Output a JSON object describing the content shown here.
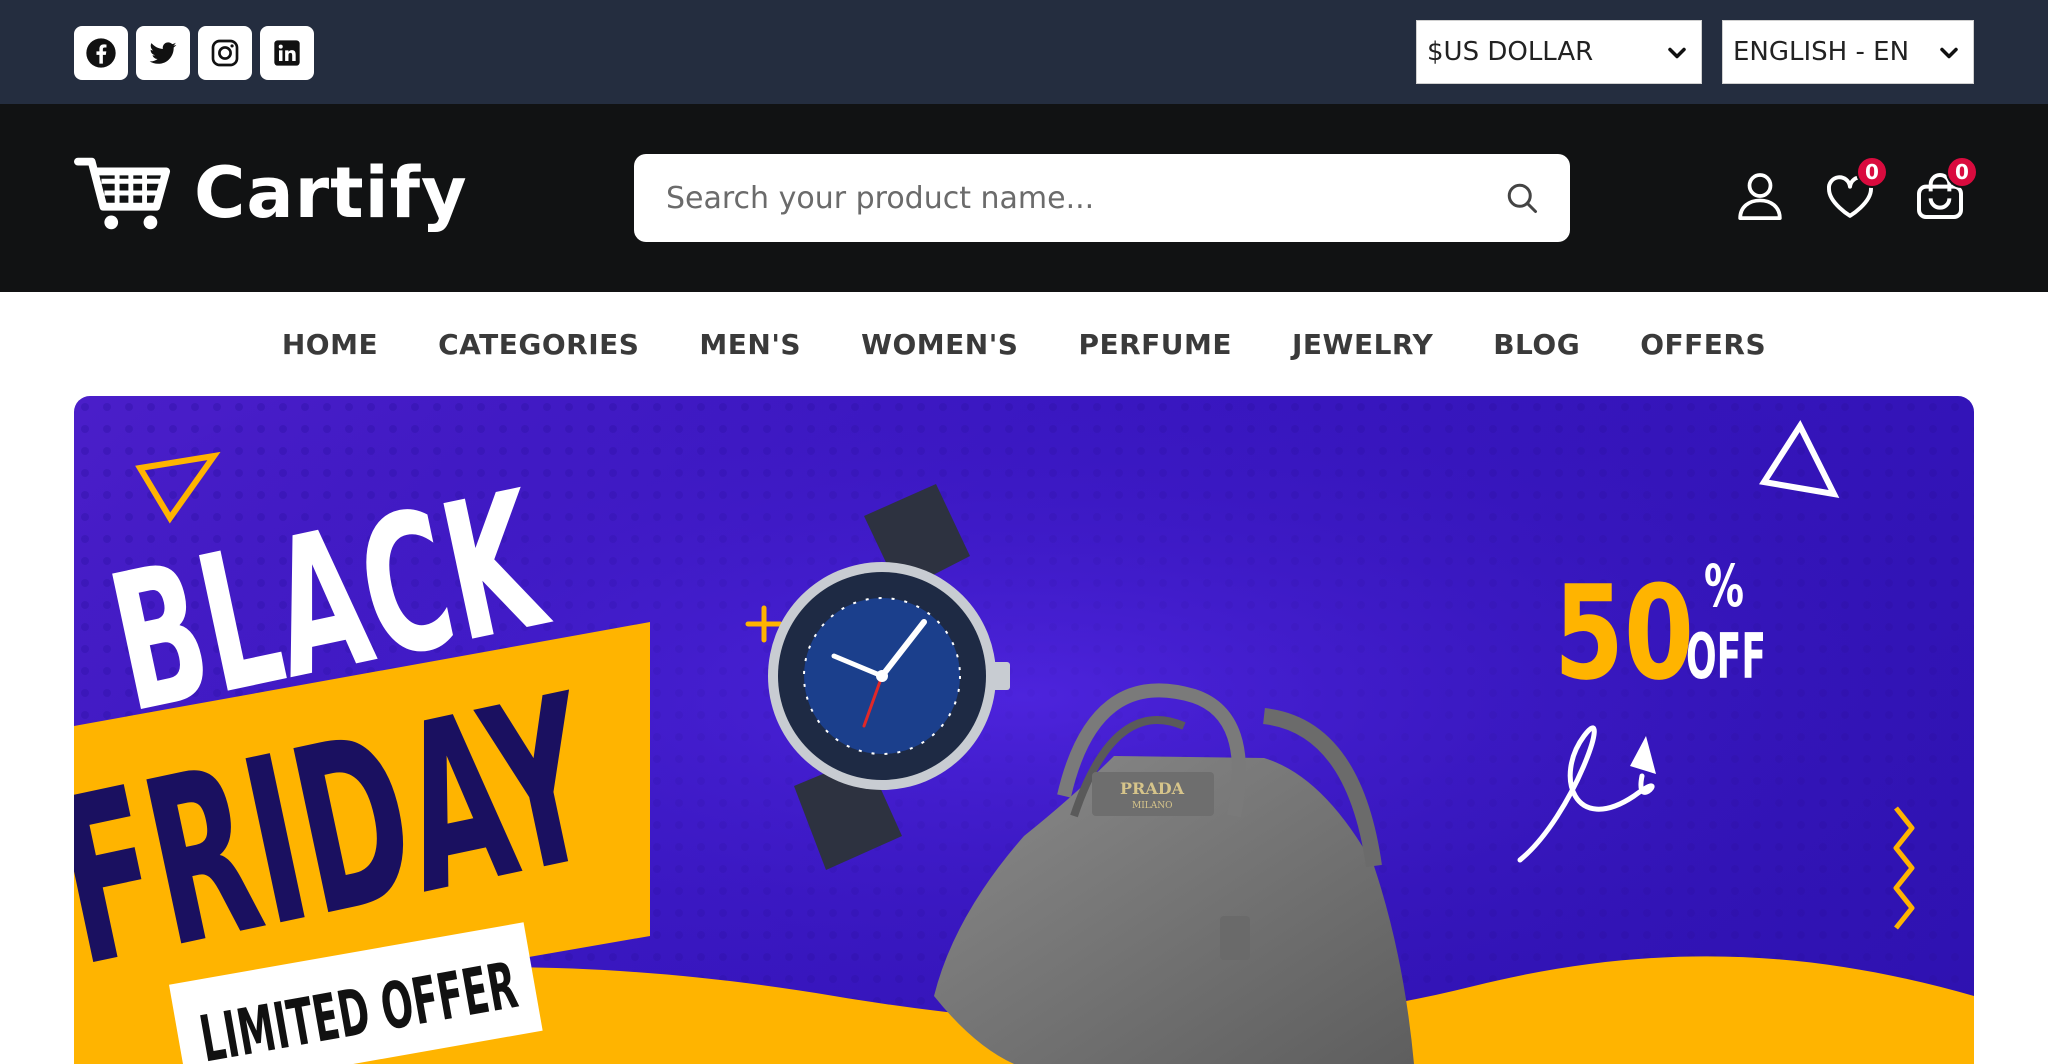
{
  "topbar": {
    "social": [
      {
        "name": "facebook-icon"
      },
      {
        "name": "twitter-icon"
      },
      {
        "name": "instagram-icon"
      },
      {
        "name": "linkedin-icon"
      }
    ],
    "currency": "$US DOLLAR",
    "language": "ENGLISH - EN"
  },
  "header": {
    "logo_text": "Cartify",
    "search_placeholder": "Search your product name...",
    "wishlist_count": "0",
    "cart_count": "0"
  },
  "nav": {
    "items": [
      "HOME",
      "CATEGORIES",
      "MEN'S",
      "WOMEN'S",
      "PERFUME",
      "JEWELRY",
      "BLOG",
      "OFFERS"
    ]
  },
  "banner": {
    "line1": "BLACK",
    "line2": "FRIDAY",
    "tagline": "LIMITED OFFER",
    "discount_number": "50",
    "discount_percent": "%",
    "discount_off": "OFF",
    "bag_brand": "PRADA",
    "bag_city": "MILANO",
    "colors": {
      "purple": "#3a17c2",
      "yellow": "#ffb400",
      "navy": "#1a1060"
    }
  },
  "colors": {
    "topbar": "#242d3f",
    "header": "#111213",
    "badge": "#d90b3e"
  }
}
